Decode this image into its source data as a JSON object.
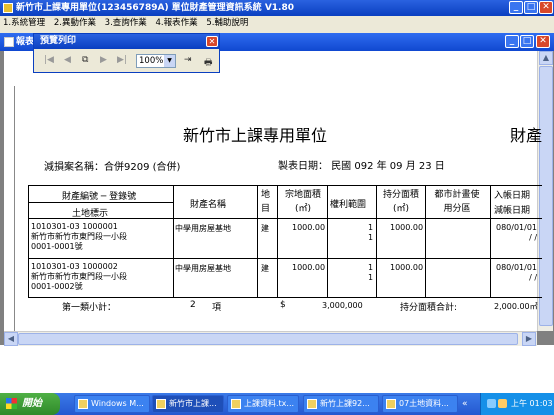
{
  "window": {
    "title": "新竹市上課專用單位(123456789A)    單位財產管理資訊系統  V1.80"
  },
  "menu": [
    "1.系統管理",
    "2.異動作業",
    "3.查詢作業",
    "4.報表作業",
    "5.輔助說明"
  ],
  "doc_window": {
    "title": "報表"
  },
  "preview": {
    "title": "預覽列印",
    "zoom": "100%"
  },
  "report": {
    "unit": "新竹市上課專用單位",
    "right_title": "財產",
    "case_label": "減損案名稱：",
    "case_value": "合併9209 (合併)",
    "date_label": "製表日期：",
    "date_value": "民國  092  年  09  月  23  日",
    "headers": {
      "c1a": "財產編號 ─ 登錄號",
      "c1b": "土地標示",
      "c2": "財產名稱",
      "c3": "地目",
      "c4": "宗地面積(㎡)",
      "c5": "權利範圍",
      "c6": "持分面積(㎡)",
      "c7": "都市計畫使用分區",
      "c8a": "入帳日期",
      "c8b": "減帳日期"
    },
    "rows": [
      {
        "id": "1010301-03     1000001",
        "loc": "新竹市新竹市東門段一小段",
        "lot": "0001-0001號",
        "name": "中學用房屋基地",
        "type": "建",
        "area": "1000.00",
        "right1": "1",
        "right2": "1",
        "share": "1000.00",
        "d1": "080/01/01",
        "d2": "/  /"
      },
      {
        "id": "1010301-03     1000002",
        "loc": "新竹市新竹市東門段一小段",
        "lot": "0001-0002號",
        "name": "中學用房屋基地",
        "type": "建",
        "area": "1000.00",
        "right1": "1",
        "right2": "1",
        "share": "1000.00",
        "d1": "080/01/01",
        "d2": "/  /"
      }
    ],
    "subtotal_label": "第一類小計：",
    "subtotal_count": "2",
    "subtotal_unit": "項",
    "currency": "$",
    "subtotal_amount": "3,000,000",
    "share_total_label": "持分面積合計:",
    "share_total_value": "2,000.00㎡"
  },
  "taskbar": {
    "start": "開始",
    "items": [
      "Windows M...",
      "新竹市上課...",
      "上課資料.tx...",
      "新竹上課92...",
      "07土地資料..."
    ],
    "clock": "上午 01:03"
  }
}
